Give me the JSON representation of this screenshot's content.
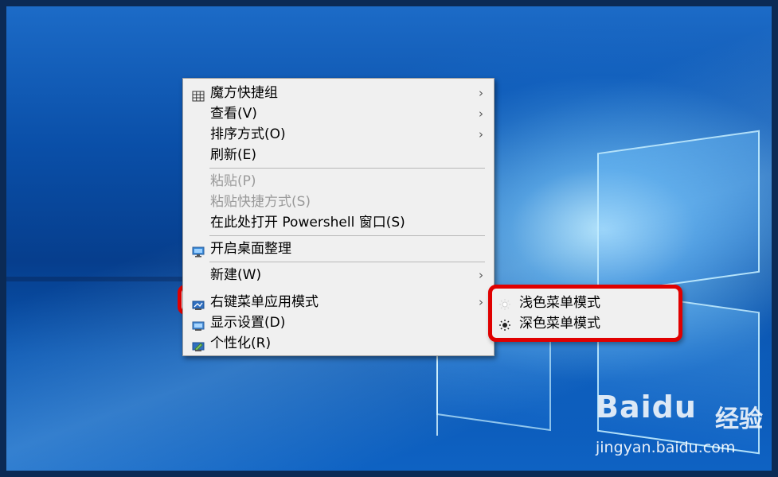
{
  "menu": {
    "items": [
      {
        "label": "魔方快捷组",
        "icon": "grid-icon",
        "submenu": true,
        "disabled": false
      },
      {
        "label": "查看(V)",
        "submenu": true,
        "disabled": false
      },
      {
        "label": "排序方式(O)",
        "submenu": true,
        "disabled": false
      },
      {
        "label": "刷新(E)",
        "submenu": false,
        "disabled": false
      },
      {
        "label": "粘贴(P)",
        "submenu": false,
        "disabled": true
      },
      {
        "label": "粘贴快捷方式(S)",
        "submenu": false,
        "disabled": true
      },
      {
        "label": "在此处打开 Powershell 窗口(S)",
        "submenu": false,
        "disabled": false
      },
      {
        "label": "开启桌面整理",
        "icon": "monitor-icon",
        "submenu": false,
        "disabled": false
      },
      {
        "label": "新建(W)",
        "submenu": true,
        "disabled": false
      },
      {
        "label": "右键菜单应用模式",
        "icon": "display-icon",
        "submenu": true,
        "disabled": false,
        "highlighted": true
      },
      {
        "label": "显示设置(D)",
        "icon": "display-icon",
        "submenu": false,
        "disabled": false
      },
      {
        "label": "个性化(R)",
        "icon": "personalize-icon",
        "submenu": false,
        "disabled": false
      }
    ]
  },
  "submenu": {
    "items": [
      {
        "label": "浅色菜单模式",
        "icon": "light-sun-icon"
      },
      {
        "label": "深色菜单模式",
        "icon": "dark-sun-icon"
      }
    ]
  },
  "watermark": {
    "logo": "Baidu",
    "cn": "经验",
    "url": "jingyan.baidu.com"
  },
  "colors": {
    "highlight_border": "#e00000",
    "menu_bg": "#f0f0f0"
  }
}
